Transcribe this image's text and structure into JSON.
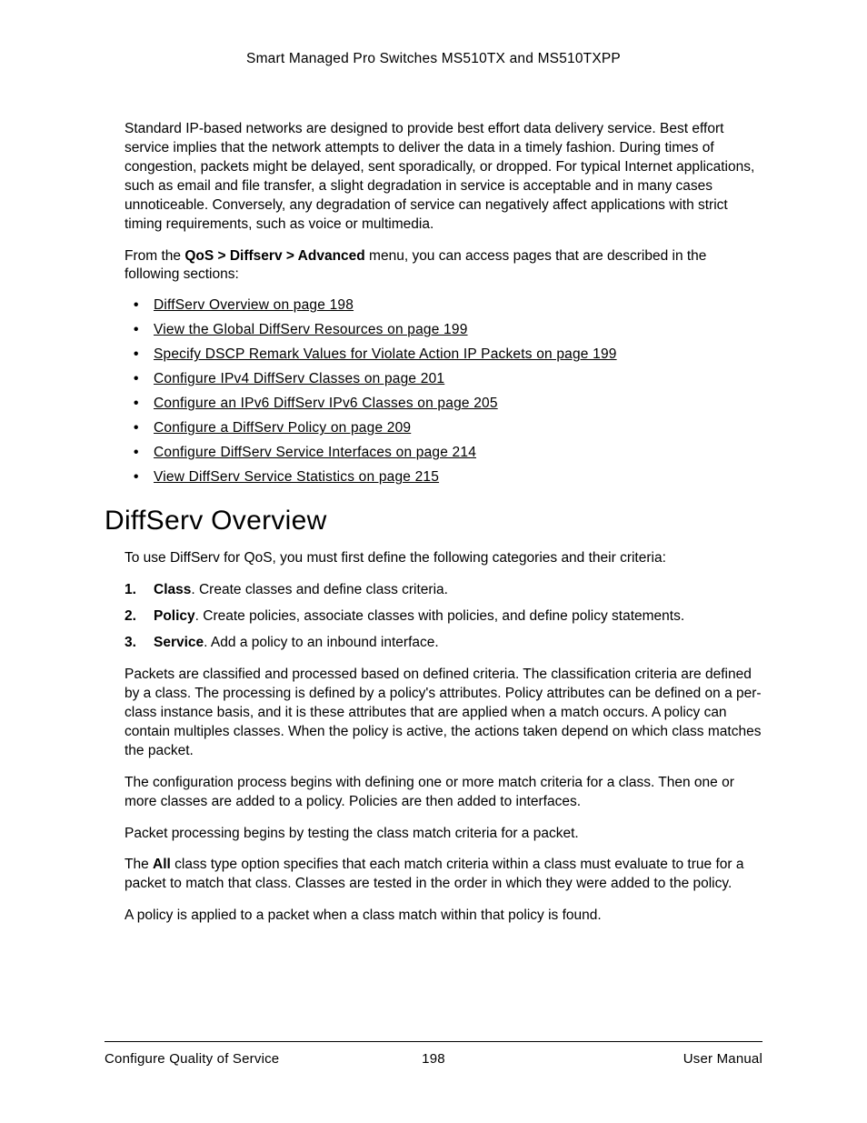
{
  "header": {
    "title": "Smart Managed Pro Switches MS510TX and MS510TXPP"
  },
  "intro": {
    "p1": "Standard IP-based networks are designed to provide best effort data delivery service. Best effort service implies that the network attempts to deliver the data in a timely fashion. During times of congestion, packets might be delayed, sent sporadically, or dropped. For typical Internet applications, such as email and file transfer, a slight degradation in service is acceptable and in many cases unnoticeable. Conversely, any degradation of service can negatively affect applications with strict timing requirements, such as voice or multimedia.",
    "p2_pre": "From the ",
    "p2_bold": "QoS > Diffserv > Advanced",
    "p2_post": " menu, you can access pages that are described in the following sections:"
  },
  "links": [
    "DiffServ Overview on page 198",
    "View the Global DiffServ Resources on page 199",
    "Specify DSCP Remark Values for Violate Action IP Packets on page 199",
    "Configure IPv4 DiffServ Classes on page 201",
    "Configure an IPv6 DiffServ IPv6 Classes on page 205",
    "Configure a DiffServ Policy on page 209",
    "Configure DiffServ Service Interfaces on page 214",
    "View DiffServ Service Statistics on page 215"
  ],
  "section": {
    "heading": "DiffServ Overview",
    "lead": "To use DiffServ for QoS, you must first define the following categories and their criteria:",
    "steps": [
      {
        "term": "Class",
        "text": ". Create classes and define class criteria."
      },
      {
        "term": "Policy",
        "text": ". Create policies, associate classes with policies, and define policy statements."
      },
      {
        "term": "Service",
        "text": ". Add a policy to an inbound interface."
      }
    ],
    "p1": "Packets are classified and processed based on defined criteria. The classification criteria are defined by a class. The processing is defined by a policy's attributes. Policy attributes can be defined on a per-class instance basis, and it is these attributes that are applied when a match occurs. A policy can contain multiples classes. When the policy is active, the actions taken depend on which class matches the packet.",
    "p2": "The configuration process begins with defining one or more match criteria for a class. Then one or more classes are added to a policy. Policies are then added to interfaces.",
    "p3": "Packet processing begins by testing the class match criteria for a packet.",
    "p4_pre": "The ",
    "p4_bold": "All",
    "p4_post": " class type option specifies that each match criteria within a class must evaluate to true for a packet to match that class. Classes are tested in the order in which they were added to the policy.",
    "p5": "A policy is applied to a packet when a class match within that policy is found."
  },
  "footer": {
    "left": "Configure Quality of Service",
    "center": "198",
    "right": "User Manual"
  }
}
